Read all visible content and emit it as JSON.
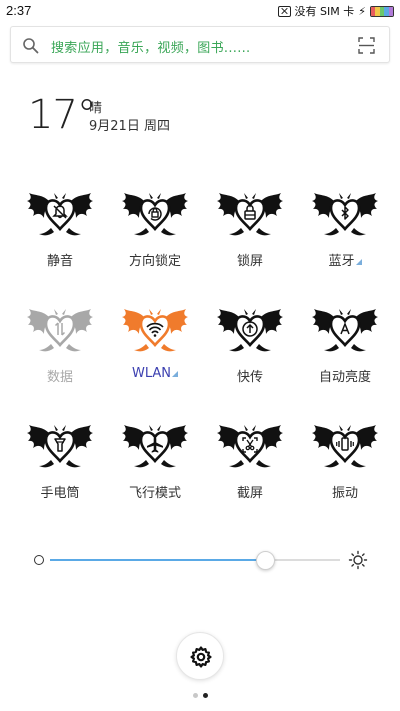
{
  "status_bar": {
    "time": "2:37",
    "carrier_text": "没有 SIM 卡",
    "icons": [
      "no-sim-icon",
      "charging-bolt-icon",
      "battery-icon"
    ],
    "battery_colors": [
      "#e85d5d",
      "#f0c84a",
      "#6cc86c",
      "#5aa9e6",
      "#b07ad8"
    ]
  },
  "search": {
    "placeholder": "搜索应用，音乐，视频，图书......",
    "icons": [
      "search-icon",
      "scan-icon"
    ],
    "placeholder_color": "#3aa657"
  },
  "weather": {
    "temperature": "17°",
    "condition": "晴",
    "date": "9月21日 周四"
  },
  "toggles": [
    {
      "label": "静音",
      "icon": "mute-bell-icon",
      "state": "off"
    },
    {
      "label": "方向锁定",
      "icon": "rotation-lock-icon",
      "state": "off"
    },
    {
      "label": "锁屏",
      "icon": "lock-screen-icon",
      "state": "off"
    },
    {
      "label": "蓝牙",
      "icon": "bluetooth-icon",
      "state": "off",
      "has_more": true
    },
    {
      "label": "数据",
      "icon": "mobile-data-icon",
      "state": "disabled"
    },
    {
      "label": "WLAN",
      "icon": "wifi-icon",
      "state": "on",
      "has_more": true
    },
    {
      "label": "快传",
      "icon": "quick-transfer-icon",
      "state": "off"
    },
    {
      "label": "自动亮度",
      "icon": "auto-brightness-icon",
      "state": "off"
    },
    {
      "label": "手电筒",
      "icon": "flashlight-icon",
      "state": "off"
    },
    {
      "label": "飞行模式",
      "icon": "airplane-icon",
      "state": "off"
    },
    {
      "label": "截屏",
      "icon": "screenshot-icon",
      "state": "off"
    },
    {
      "label": "振动",
      "icon": "vibrate-icon",
      "state": "off"
    }
  ],
  "toggle_colors": {
    "off": "#111111",
    "disabled": "#a8a8a8",
    "on": "#f07b2c",
    "on_label": "#3b3fb0",
    "more_indicator": "#7aaedc"
  },
  "brightness": {
    "level": 0.74,
    "icons": [
      "brightness-low-icon",
      "brightness-high-icon"
    ],
    "fill_color": "#5aa9e6"
  },
  "settings": {
    "icon": "gear-icon"
  },
  "pager": {
    "pages": 2,
    "current": 2
  }
}
